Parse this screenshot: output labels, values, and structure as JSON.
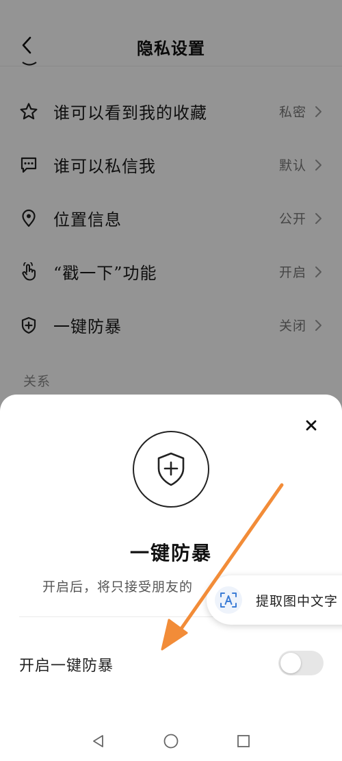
{
  "header": {
    "title": "隐私设置"
  },
  "settings": [
    {
      "label": "谁可以看到我的收藏",
      "value": "私密",
      "icon": "star-icon"
    },
    {
      "label": "谁可以私信我",
      "value": "默认",
      "icon": "message-icon"
    },
    {
      "label": "位置信息",
      "value": "公开",
      "icon": "location-pin-icon"
    },
    {
      "label": "“戳一下”功能",
      "value": "开启",
      "icon": "tap-hand-icon"
    },
    {
      "label": "一键防暴",
      "value": "关闭",
      "icon": "shield-plus-icon"
    }
  ],
  "section": {
    "title": "关系"
  },
  "sheet": {
    "title": "一键防暴",
    "description": "开启后，将只接受朋友的",
    "toggle_label": "开启一键防暴",
    "toggle_on": false
  },
  "extract": {
    "label": "提取图中文字"
  },
  "colors": {
    "overlay": "#000000",
    "annotation_arrow": "#f28c38",
    "extract_accent": "#3a7bd5"
  }
}
